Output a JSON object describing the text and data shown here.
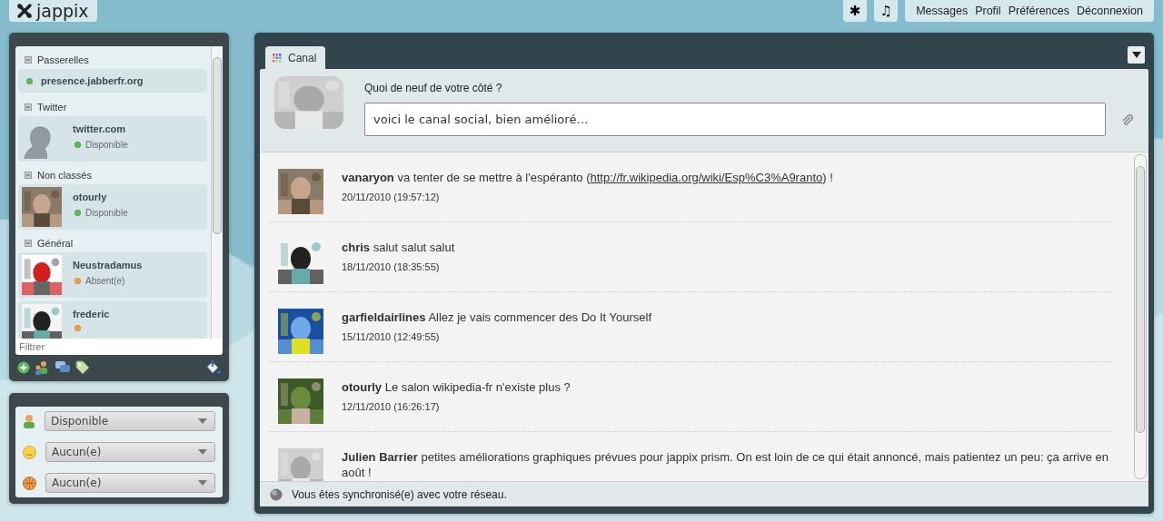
{
  "top_bar": {
    "logo": "jappix",
    "tool_buttons": [
      "✱",
      "♫"
    ],
    "menu": [
      "Messages",
      "Profil",
      "Préférences",
      "Déconnexion"
    ]
  },
  "roster": {
    "groups": [
      {
        "name": "Passerelles",
        "kind": "gateway",
        "contacts": [
          {
            "name": "presence.jabberfr.org",
            "color": "#5cb85c"
          }
        ]
      },
      {
        "name": "Twitter",
        "kind": "contacts",
        "contacts": [
          {
            "name": "twitter.com",
            "kind": "silhouette",
            "color": "#5cb85c",
            "status_text": "Disponible"
          }
        ]
      },
      {
        "name": "Non classés",
        "kind": "contacts",
        "contacts": [
          {
            "name": "otourly",
            "kind": "picture",
            "color": "#5cb85c",
            "status_text": "Disponible"
          }
        ]
      },
      {
        "name": "Général",
        "kind": "contacts",
        "contacts": [
          {
            "name": "Neustradamus",
            "kind": "picture",
            "color": "#f0a040",
            "status_text": "Absent(e)"
          },
          {
            "name": "frederic",
            "kind": "picture",
            "color": "#f0a040"
          }
        ]
      }
    ],
    "filter": {
      "placeholder": "Filtrer"
    }
  },
  "presence": [
    {
      "kind": "status",
      "value": "Disponible"
    },
    {
      "kind": "mood",
      "value": "Aucun(e)"
    },
    {
      "kind": "activity",
      "value": "Aucun(e)"
    }
  ],
  "main": {
    "tabs": [
      {
        "label": "Canal",
        "selected": true
      }
    ],
    "composer": {
      "prompt": "Quoi de neuf de votre côté ?",
      "value": "voici le canal social, bien amélioré…"
    },
    "feed": [
      {
        "author": "vanaryon",
        "text": "va tenter de se mettre à l'espéranto (",
        "link": "http://fr.wikipedia.org/wiki/Esp%C3%A9ranto",
        "text_after": ") !",
        "time": "20/11/2010 (19:57:12)"
      },
      {
        "author": "chris",
        "text": "salut salut salut",
        "time": "18/11/2010 (18:35:55)"
      },
      {
        "author": "garfieldairlines",
        "text": "Allez je vais commencer des Do It Yourself",
        "time": "15/11/2010 (12:49:55)"
      },
      {
        "author": "otourly",
        "text": "Le salon wikipedia-fr n'existe plus ?",
        "time": "12/11/2010 (16:26:17)"
      },
      {
        "author": "Julien Barrier",
        "text": "petites améliorations graphiques prévues pour jappix prism. On est loin de ce qui était annoncé, mais patientez un peu: ça arrive en août !"
      }
    ],
    "status_bar": "Vous êtes synchronisé(e) avec votre réseau."
  }
}
